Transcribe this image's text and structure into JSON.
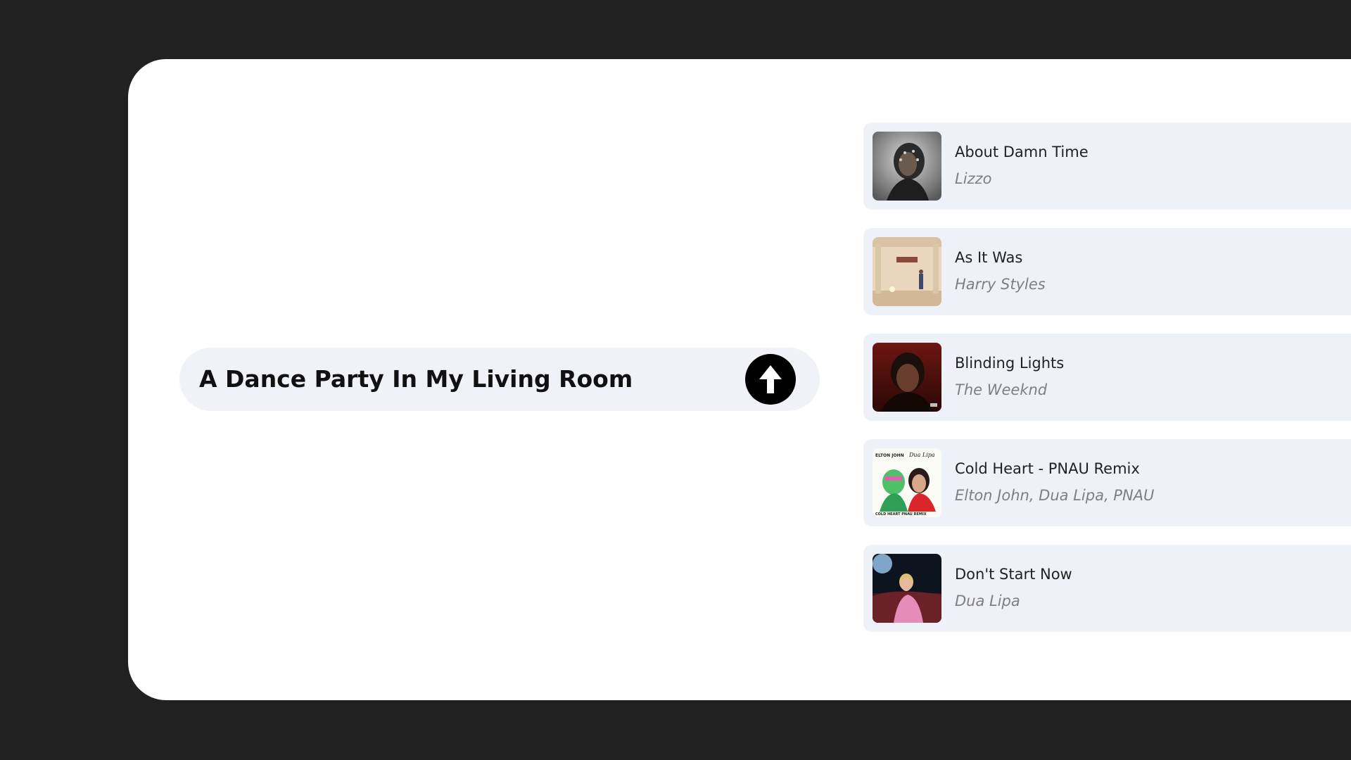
{
  "prompt": {
    "text": "A Dance Party In My Living Room"
  },
  "songs": [
    {
      "title": "About Damn Time",
      "artist": "Lizzo"
    },
    {
      "title": "As It Was",
      "artist": "Harry Styles"
    },
    {
      "title": "Blinding Lights",
      "artist": "The Weeknd"
    },
    {
      "title": "Cold Heart - PNAU Remix",
      "artist": "Elton John, Dua Lipa, PNAU"
    },
    {
      "title": "Don't Start Now",
      "artist": "Dua Lipa"
    }
  ],
  "covers": {
    "cold_heart_caption_left": "ELTON JOHN",
    "cold_heart_caption_right": "Dua Lipa",
    "cold_heart_footer": "COLD HEART PNAU REMIX"
  },
  "colors": {
    "background": "#212121",
    "panel": "#ffffff",
    "card": "#eff1f8",
    "prompt_bar": "#f0f2f7",
    "button": "#000000",
    "artist_text": "#7d7f87"
  },
  "icons": {
    "submit": "arrow-up-icon"
  }
}
